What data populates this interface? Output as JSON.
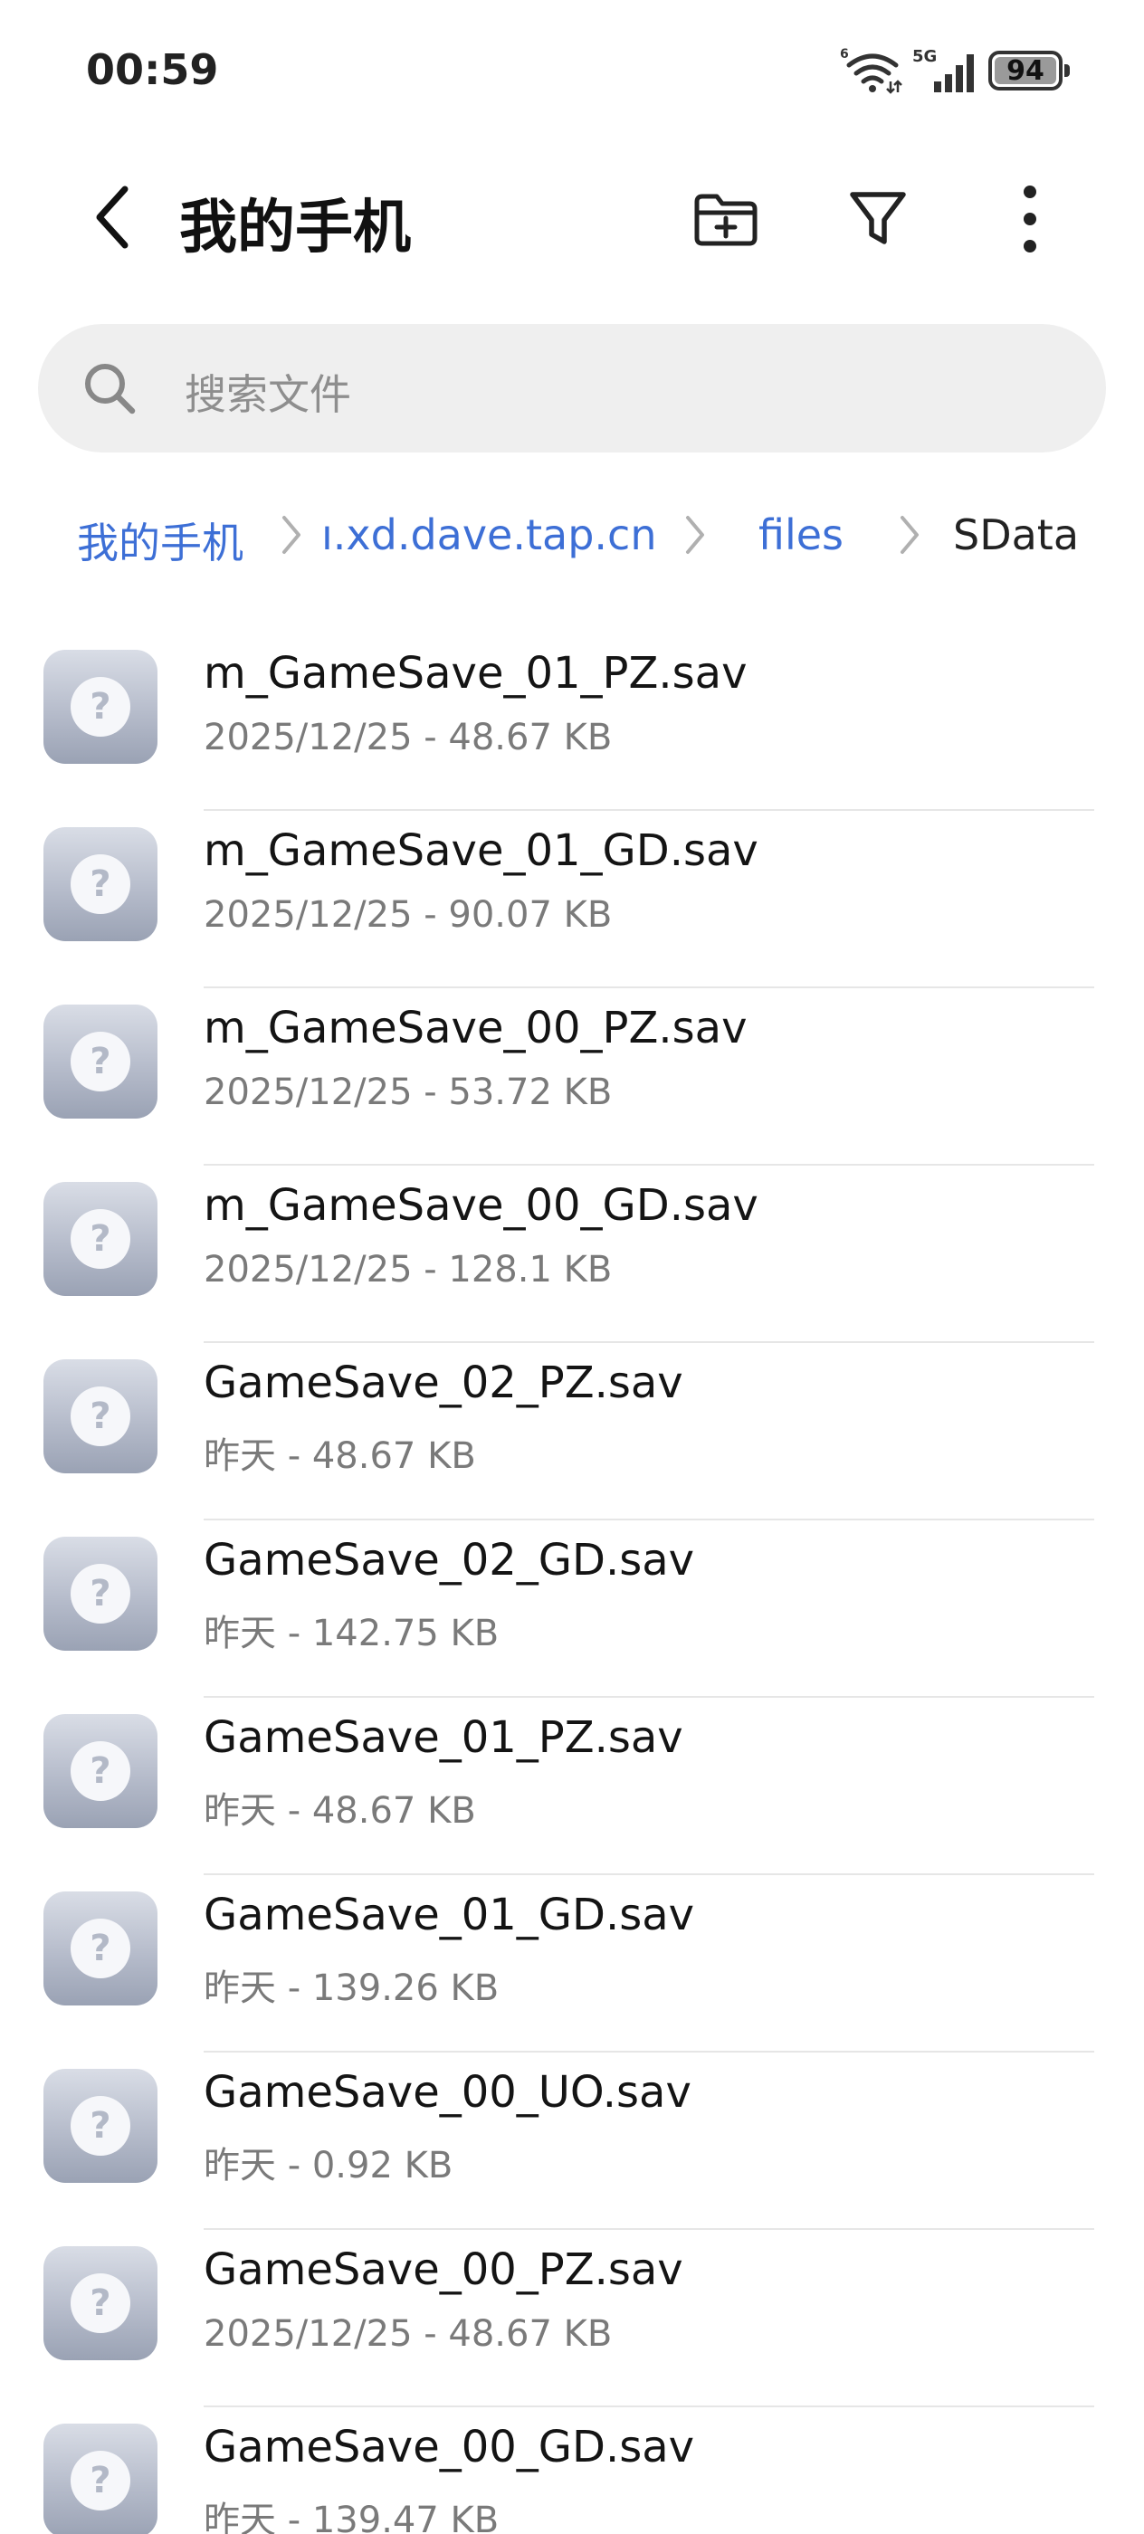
{
  "status_bar": {
    "time": "00:59",
    "battery": "94",
    "network": "5G",
    "wifi_tag": "6"
  },
  "header": {
    "title": "我的手机",
    "icons": [
      "back-arrow-icon",
      "new-folder-icon",
      "filter-icon",
      "more-vert-icon"
    ]
  },
  "search": {
    "placeholder": "搜索文件"
  },
  "breadcrumb": [
    {
      "label": "我的手机"
    },
    {
      "label": "ı.xd.dave.tap.cn"
    },
    {
      "label": "files"
    },
    {
      "label": "SData"
    }
  ],
  "files": [
    {
      "name": "m_GameSave_01_PZ.sav",
      "meta": "2025/12/25 - 48.67 KB"
    },
    {
      "name": "m_GameSave_01_GD.sav",
      "meta": "2025/12/25 - 90.07 KB"
    },
    {
      "name": "m_GameSave_00_PZ.sav",
      "meta": "2025/12/25 - 53.72 KB"
    },
    {
      "name": "m_GameSave_00_GD.sav",
      "meta": "2025/12/25 - 128.1 KB"
    },
    {
      "name": "GameSave_02_PZ.sav",
      "meta": "昨天 - 48.67 KB"
    },
    {
      "name": "GameSave_02_GD.sav",
      "meta": "昨天 - 142.75 KB"
    },
    {
      "name": "GameSave_01_PZ.sav",
      "meta": "昨天 - 48.67 KB"
    },
    {
      "name": "GameSave_01_GD.sav",
      "meta": "昨天 - 139.26 KB"
    },
    {
      "name": "GameSave_00_UO.sav",
      "meta": "昨天 - 0.92 KB"
    },
    {
      "name": "GameSave_00_PZ.sav",
      "meta": "2025/12/25 - 48.67 KB"
    },
    {
      "name": "GameSave_00_GD.sav",
      "meta": "昨天 - 139.47 KB"
    }
  ],
  "colors": {
    "accent": "#3d6fd6",
    "search_bg": "#efefef",
    "divider": "#e6e6e6"
  }
}
